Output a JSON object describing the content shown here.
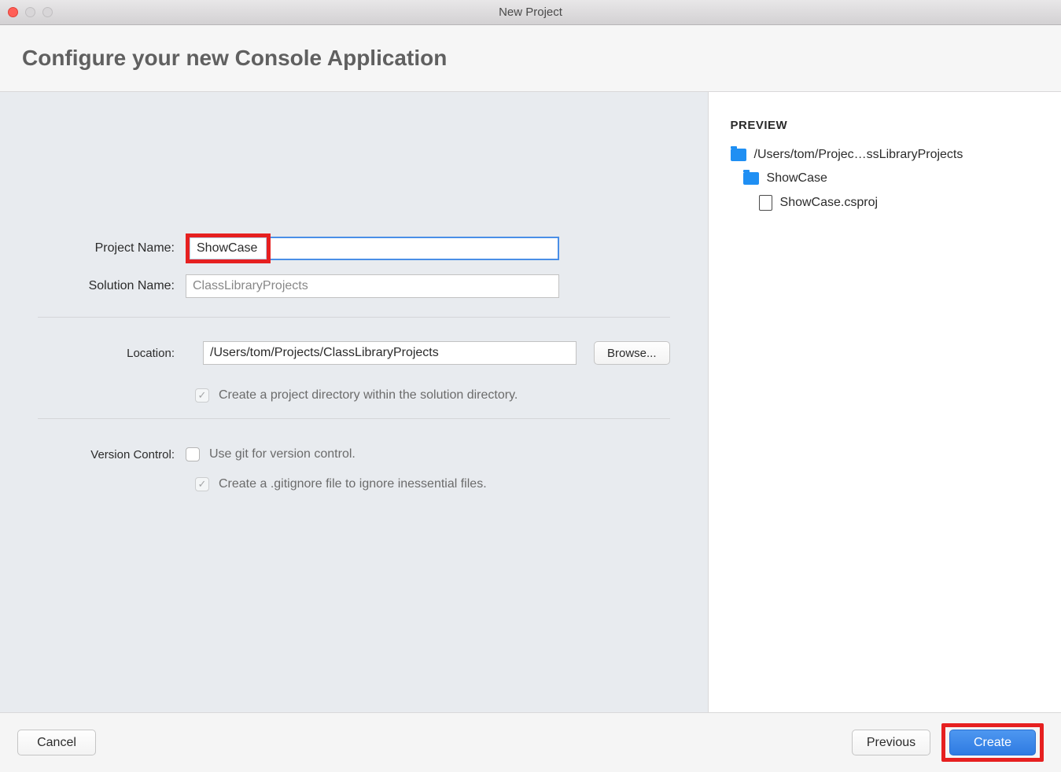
{
  "window": {
    "title": "New Project"
  },
  "header": {
    "heading": "Configure your new Console Application"
  },
  "form": {
    "projectName": {
      "label": "Project Name:",
      "value": "ShowCase"
    },
    "solutionName": {
      "label": "Solution Name:",
      "value": "ClassLibraryProjects"
    },
    "location": {
      "label": "Location:",
      "value": "/Users/tom/Projects/ClassLibraryProjects"
    },
    "browseLabel": "Browse...",
    "createDirLabel": "Create a project directory within the solution directory.",
    "versionControl": {
      "label": "Version Control:",
      "useGitLabel": "Use git for version control.",
      "gitignoreLabel": "Create a .gitignore file to ignore inessential files."
    }
  },
  "preview": {
    "title": "PREVIEW",
    "root": "/Users/tom/Projec…ssLibraryProjects",
    "folder": "ShowCase",
    "file": "ShowCase.csproj"
  },
  "footer": {
    "cancel": "Cancel",
    "previous": "Previous",
    "create": "Create"
  }
}
